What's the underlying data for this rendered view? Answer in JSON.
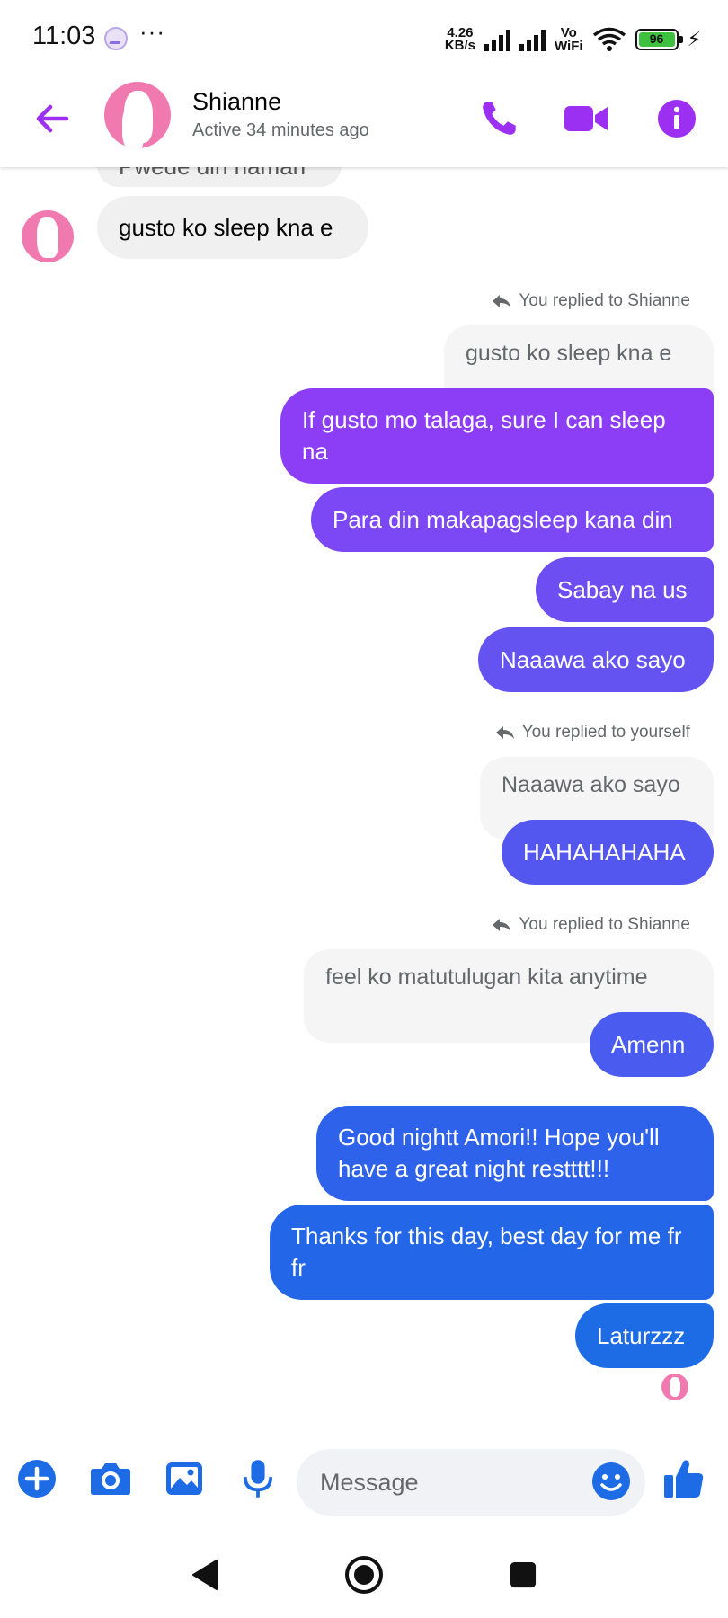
{
  "status_bar": {
    "time": "11:03",
    "more": "···",
    "net_speed_value": "4.26",
    "net_speed_unit": "KB/s",
    "vowifi_top": "Vo",
    "vowifi_bottom": "WiFi",
    "battery": "96"
  },
  "header": {
    "contact_name": "Shianne",
    "contact_status": "Active 34 minutes ago",
    "icons": {
      "back": "arrow-left-icon",
      "call": "phone-icon",
      "video": "video-camera-icon",
      "info": "info-icon"
    }
  },
  "colors": {
    "accent": "#9b30f2",
    "bubble_in": "#f0f0f0",
    "bubble_out_top": "#8b3ef5",
    "bubble_out_bottom": "#1e6be6"
  },
  "messages": {
    "partial_top": "Pwede din naman",
    "m1": "gusto ko sleep kna e",
    "reply_label_1": "You replied to Shianne",
    "quoted_1": "gusto ko sleep kna e",
    "m2": "If gusto mo talaga, sure I can sleep na",
    "m3": "Para din makapagsleep kana din",
    "m4": "Sabay na us",
    "m5": "Naaawa ako sayo",
    "reply_label_2": "You replied to yourself",
    "quoted_2": "Naaawa ako sayo",
    "m6": "HAHAHAHAHA",
    "reply_label_3": "You replied to Shianne",
    "quoted_3": "feel ko matutulugan kita anytime",
    "m7": "Amenn",
    "m8": "Good nightt Amori!! Hope you'll have a great night restttt!!!",
    "m9": "Thanks for this day, best day for me fr fr",
    "m10": "Laturzzz"
  },
  "composer": {
    "placeholder": "Message",
    "icons": [
      "plus-icon",
      "camera-icon",
      "image-icon",
      "microphone-icon",
      "emoji-icon",
      "thumbs-up-icon"
    ]
  },
  "nav": {
    "icons": [
      "back-triangle-icon",
      "home-circle-icon",
      "recents-square-icon"
    ]
  }
}
